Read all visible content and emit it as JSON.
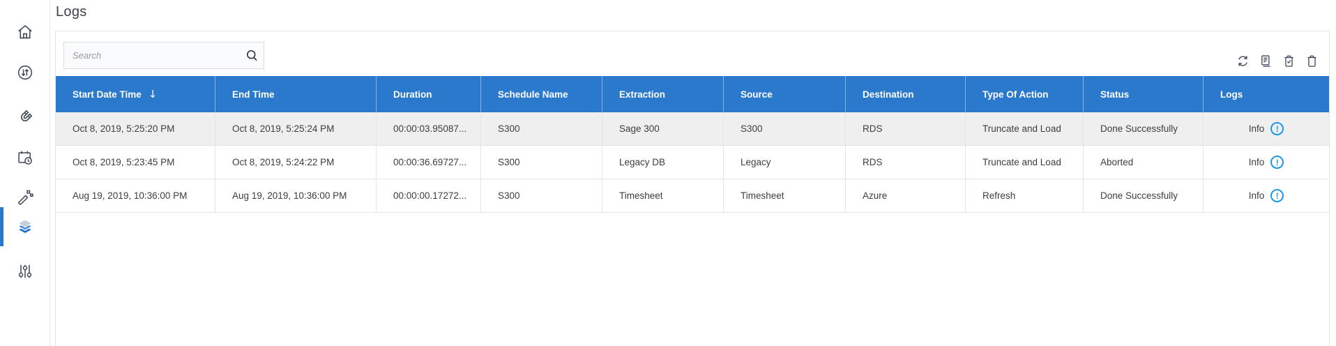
{
  "page": {
    "title": "Logs"
  },
  "sidebar": {
    "items": [
      {
        "name": "home",
        "icon": "home-icon",
        "active": false
      },
      {
        "name": "transfer",
        "icon": "transfer-circle-icon",
        "active": false
      },
      {
        "name": "connections",
        "icon": "magnet-icon",
        "active": false
      },
      {
        "name": "schedules",
        "icon": "calendar-clock-icon",
        "active": false
      },
      {
        "name": "automation",
        "icon": "magic-wand-icon",
        "active": false
      },
      {
        "name": "logs",
        "icon": "layers-icon",
        "active": true
      },
      {
        "name": "settings",
        "icon": "sliders-icon",
        "active": false
      }
    ]
  },
  "toolbar": {
    "search_placeholder": "Search",
    "icons": [
      "refresh-icon",
      "log-document-icon",
      "trash-check-icon",
      "trash-icon"
    ]
  },
  "table": {
    "sort_glyph": "↓",
    "info_icon_glyph": "!",
    "columns": [
      {
        "label": "Start Date Time",
        "sorted": "desc"
      },
      {
        "label": "End Time"
      },
      {
        "label": "Duration"
      },
      {
        "label": "Schedule Name"
      },
      {
        "label": "Extraction"
      },
      {
        "label": "Source"
      },
      {
        "label": "Destination"
      },
      {
        "label": "Type Of Action"
      },
      {
        "label": "Status"
      },
      {
        "label": "Logs"
      }
    ],
    "rows": [
      {
        "start": "Oct 8, 2019, 5:25:20 PM",
        "end": "Oct 8, 2019, 5:25:24 PM",
        "duration": "00:00:03.95087...",
        "schedule": "S300",
        "extraction": "Sage 300",
        "source": "S300",
        "destination": "RDS",
        "action": "Truncate and Load",
        "status": "Done Successfully",
        "logs_label": "Info"
      },
      {
        "start": "Oct 8, 2019, 5:23:45 PM",
        "end": "Oct 8, 2019, 5:24:22 PM",
        "duration": "00:00:36.69727...",
        "schedule": "S300",
        "extraction": "Legacy DB",
        "source": "Legacy",
        "destination": "RDS",
        "action": "Truncate and Load",
        "status": "Aborted",
        "logs_label": "Info"
      },
      {
        "start": "Aug 19, 2019, 10:36:00 PM",
        "end": "Aug 19, 2019, 10:36:00 PM",
        "duration": "00:00:00.17272...",
        "schedule": "S300",
        "extraction": "Timesheet",
        "source": "Timesheet",
        "destination": "Azure",
        "action": "Refresh",
        "status": "Done Successfully",
        "logs_label": "Info"
      }
    ]
  },
  "colors": {
    "header_bg": "#2b79cd",
    "active_blue": "#2b79cd",
    "row_alt": "#efefef",
    "border": "#e1e3e6",
    "info_blue": "#1e96ea",
    "icon_dark": "#3e4857"
  }
}
